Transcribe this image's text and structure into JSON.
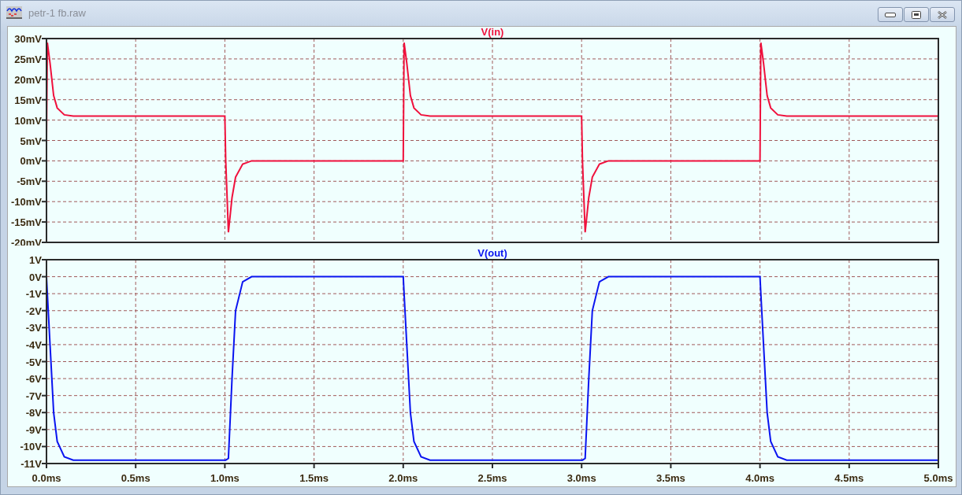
{
  "window": {
    "title": "petr-1 fb.raw",
    "buttons": [
      {
        "kind": "minimize"
      },
      {
        "kind": "maximize"
      },
      {
        "kind": "close"
      }
    ]
  },
  "panes": [
    {
      "chart_data": {
        "type": "line",
        "grid": true,
        "xlim": [
          0,
          5
        ],
        "ylim": [
          -20,
          30
        ],
        "x": [
          0,
          0.005,
          0.02,
          0.04,
          0.06,
          0.1,
          0.15,
          1,
          1.005,
          1.02,
          1.04,
          1.06,
          1.1,
          1.15,
          2,
          2.005,
          2.02,
          2.04,
          2.06,
          2.1,
          2.15,
          3,
          3.005,
          3.02,
          3.04,
          3.06,
          3.1,
          3.15,
          4,
          4.005,
          4.02,
          4.04,
          4.06,
          4.1,
          4.15,
          5
        ],
        "series": [
          {
            "name": "V(in)",
            "color": "#f0103c",
            "values": [
              5,
              29,
              24,
              16,
              13,
              11.3,
              11,
              11,
              0,
              -17.5,
              -9,
              -4,
              -0.8,
              0,
              0,
              29,
              24,
              16,
              13,
              11.3,
              11,
              11,
              0,
              -17.5,
              -9,
              -4,
              -0.8,
              0,
              0,
              29,
              24,
              16,
              13,
              11.3,
              11,
              11
            ]
          }
        ],
        "yticks": [
          {
            "value": 30,
            "label": "30mV"
          },
          {
            "value": 25,
            "label": "25mV"
          },
          {
            "value": 20,
            "label": "20mV"
          },
          {
            "value": 15,
            "label": "15mV"
          },
          {
            "value": 10,
            "label": "10mV"
          },
          {
            "value": 5,
            "label": "5mV"
          },
          {
            "value": 0,
            "label": "0mV"
          },
          {
            "value": -5,
            "label": "-5mV"
          },
          {
            "value": -10,
            "label": "-10mV"
          },
          {
            "value": -15,
            "label": "-15mV"
          },
          {
            "value": -20,
            "label": "-20mV"
          }
        ]
      }
    },
    {
      "chart_data": {
        "type": "line",
        "grid": true,
        "xlim": [
          0,
          5
        ],
        "ylim": [
          -11,
          1
        ],
        "x": [
          0,
          0.005,
          0.02,
          0.04,
          0.06,
          0.1,
          0.15,
          1,
          1.005,
          1.02,
          1.04,
          1.06,
          1.1,
          1.15,
          2,
          2.005,
          2.02,
          2.04,
          2.06,
          2.1,
          2.15,
          3,
          3.005,
          3.02,
          3.04,
          3.06,
          3.1,
          3.15,
          4,
          4.005,
          4.02,
          4.04,
          4.06,
          4.1,
          4.15,
          5
        ],
        "series": [
          {
            "name": "V(out)",
            "color": "#0a14f0",
            "values": [
              0,
              -1,
              -4,
              -8,
              -9.7,
              -10.6,
              -10.8,
              -10.8,
              -10.8,
              -10.7,
              -6,
              -2,
              -0.3,
              0,
              0,
              -1,
              -4,
              -8,
              -9.7,
              -10.6,
              -10.8,
              -10.8,
              -10.8,
              -10.7,
              -6,
              -2,
              -0.3,
              0,
              0,
              -1,
              -4,
              -8,
              -9.7,
              -10.6,
              -10.8,
              -10.8
            ]
          }
        ],
        "xticks": [
          {
            "value": 0,
            "label": "0.0ms"
          },
          {
            "value": 0.5,
            "label": "0.5ms"
          },
          {
            "value": 1,
            "label": "1.0ms"
          },
          {
            "value": 1.5,
            "label": "1.5ms"
          },
          {
            "value": 2,
            "label": "2.0ms"
          },
          {
            "value": 2.5,
            "label": "2.5ms"
          },
          {
            "value": 3,
            "label": "3.0ms"
          },
          {
            "value": 3.5,
            "label": "3.5ms"
          },
          {
            "value": 4,
            "label": "4.0ms"
          },
          {
            "value": 4.5,
            "label": "4.5ms"
          },
          {
            "value": 5,
            "label": "5.0ms"
          }
        ],
        "yticks": [
          {
            "value": 1,
            "label": "1V"
          },
          {
            "value": 0,
            "label": "0V"
          },
          {
            "value": -1,
            "label": "-1V"
          },
          {
            "value": -2,
            "label": "-2V"
          },
          {
            "value": -3,
            "label": "-3V"
          },
          {
            "value": -4,
            "label": "-4V"
          },
          {
            "value": -5,
            "label": "-5V"
          },
          {
            "value": -6,
            "label": "-6V"
          },
          {
            "value": -7,
            "label": "-7V"
          },
          {
            "value": -8,
            "label": "-8V"
          },
          {
            "value": -9,
            "label": "-9V"
          },
          {
            "value": -10,
            "label": "-10V"
          },
          {
            "value": -11,
            "label": "-11V"
          }
        ]
      }
    }
  ]
}
